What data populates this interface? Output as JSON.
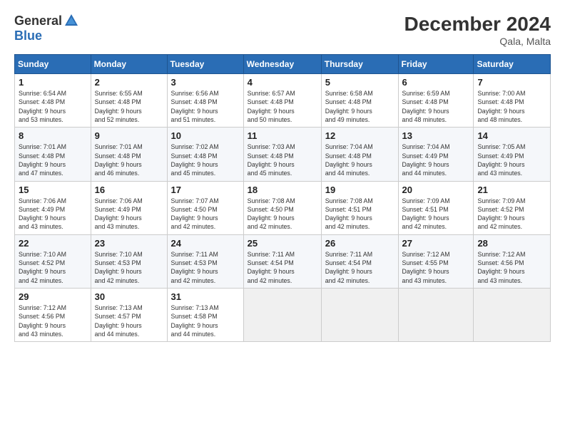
{
  "header": {
    "logo_general": "General",
    "logo_blue": "Blue",
    "month_title": "December 2024",
    "location": "Qala, Malta"
  },
  "days_of_week": [
    "Sunday",
    "Monday",
    "Tuesday",
    "Wednesday",
    "Thursday",
    "Friday",
    "Saturday"
  ],
  "weeks": [
    [
      {
        "day": "1",
        "info": "Sunrise: 6:54 AM\nSunset: 4:48 PM\nDaylight: 9 hours\nand 53 minutes."
      },
      {
        "day": "2",
        "info": "Sunrise: 6:55 AM\nSunset: 4:48 PM\nDaylight: 9 hours\nand 52 minutes."
      },
      {
        "day": "3",
        "info": "Sunrise: 6:56 AM\nSunset: 4:48 PM\nDaylight: 9 hours\nand 51 minutes."
      },
      {
        "day": "4",
        "info": "Sunrise: 6:57 AM\nSunset: 4:48 PM\nDaylight: 9 hours\nand 50 minutes."
      },
      {
        "day": "5",
        "info": "Sunrise: 6:58 AM\nSunset: 4:48 PM\nDaylight: 9 hours\nand 49 minutes."
      },
      {
        "day": "6",
        "info": "Sunrise: 6:59 AM\nSunset: 4:48 PM\nDaylight: 9 hours\nand 48 minutes."
      },
      {
        "day": "7",
        "info": "Sunrise: 7:00 AM\nSunset: 4:48 PM\nDaylight: 9 hours\nand 48 minutes."
      }
    ],
    [
      {
        "day": "8",
        "info": "Sunrise: 7:01 AM\nSunset: 4:48 PM\nDaylight: 9 hours\nand 47 minutes."
      },
      {
        "day": "9",
        "info": "Sunrise: 7:01 AM\nSunset: 4:48 PM\nDaylight: 9 hours\nand 46 minutes."
      },
      {
        "day": "10",
        "info": "Sunrise: 7:02 AM\nSunset: 4:48 PM\nDaylight: 9 hours\nand 45 minutes."
      },
      {
        "day": "11",
        "info": "Sunrise: 7:03 AM\nSunset: 4:48 PM\nDaylight: 9 hours\nand 45 minutes."
      },
      {
        "day": "12",
        "info": "Sunrise: 7:04 AM\nSunset: 4:48 PM\nDaylight: 9 hours\nand 44 minutes."
      },
      {
        "day": "13",
        "info": "Sunrise: 7:04 AM\nSunset: 4:49 PM\nDaylight: 9 hours\nand 44 minutes."
      },
      {
        "day": "14",
        "info": "Sunrise: 7:05 AM\nSunset: 4:49 PM\nDaylight: 9 hours\nand 43 minutes."
      }
    ],
    [
      {
        "day": "15",
        "info": "Sunrise: 7:06 AM\nSunset: 4:49 PM\nDaylight: 9 hours\nand 43 minutes."
      },
      {
        "day": "16",
        "info": "Sunrise: 7:06 AM\nSunset: 4:49 PM\nDaylight: 9 hours\nand 43 minutes."
      },
      {
        "day": "17",
        "info": "Sunrise: 7:07 AM\nSunset: 4:50 PM\nDaylight: 9 hours\nand 42 minutes."
      },
      {
        "day": "18",
        "info": "Sunrise: 7:08 AM\nSunset: 4:50 PM\nDaylight: 9 hours\nand 42 minutes."
      },
      {
        "day": "19",
        "info": "Sunrise: 7:08 AM\nSunset: 4:51 PM\nDaylight: 9 hours\nand 42 minutes."
      },
      {
        "day": "20",
        "info": "Sunrise: 7:09 AM\nSunset: 4:51 PM\nDaylight: 9 hours\nand 42 minutes."
      },
      {
        "day": "21",
        "info": "Sunrise: 7:09 AM\nSunset: 4:52 PM\nDaylight: 9 hours\nand 42 minutes."
      }
    ],
    [
      {
        "day": "22",
        "info": "Sunrise: 7:10 AM\nSunset: 4:52 PM\nDaylight: 9 hours\nand 42 minutes."
      },
      {
        "day": "23",
        "info": "Sunrise: 7:10 AM\nSunset: 4:53 PM\nDaylight: 9 hours\nand 42 minutes."
      },
      {
        "day": "24",
        "info": "Sunrise: 7:11 AM\nSunset: 4:53 PM\nDaylight: 9 hours\nand 42 minutes."
      },
      {
        "day": "25",
        "info": "Sunrise: 7:11 AM\nSunset: 4:54 PM\nDaylight: 9 hours\nand 42 minutes."
      },
      {
        "day": "26",
        "info": "Sunrise: 7:11 AM\nSunset: 4:54 PM\nDaylight: 9 hours\nand 42 minutes."
      },
      {
        "day": "27",
        "info": "Sunrise: 7:12 AM\nSunset: 4:55 PM\nDaylight: 9 hours\nand 43 minutes."
      },
      {
        "day": "28",
        "info": "Sunrise: 7:12 AM\nSunset: 4:56 PM\nDaylight: 9 hours\nand 43 minutes."
      }
    ],
    [
      {
        "day": "29",
        "info": "Sunrise: 7:12 AM\nSunset: 4:56 PM\nDaylight: 9 hours\nand 43 minutes."
      },
      {
        "day": "30",
        "info": "Sunrise: 7:13 AM\nSunset: 4:57 PM\nDaylight: 9 hours\nand 44 minutes."
      },
      {
        "day": "31",
        "info": "Sunrise: 7:13 AM\nSunset: 4:58 PM\nDaylight: 9 hours\nand 44 minutes."
      },
      {
        "day": "",
        "info": ""
      },
      {
        "day": "",
        "info": ""
      },
      {
        "day": "",
        "info": ""
      },
      {
        "day": "",
        "info": ""
      }
    ]
  ]
}
